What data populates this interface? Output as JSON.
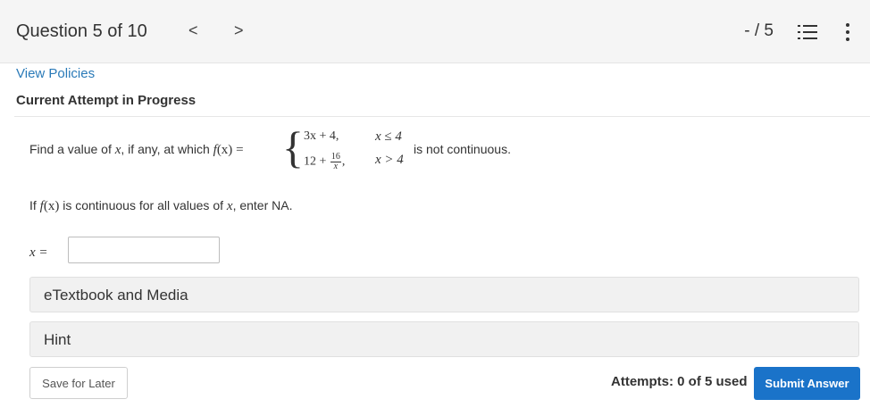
{
  "header": {
    "question_label": "Question 5 of 10",
    "prev_icon": "chevron-left-icon",
    "prev_glyph": "<",
    "next_icon": "chevron-right-icon",
    "next_glyph": ">",
    "score": "- / 5",
    "list_icon": "list-icon",
    "menu_icon": "more-vertical-icon"
  },
  "links": {
    "view_policies": "View Policies"
  },
  "attempt_title": "Current Attempt in Progress",
  "question": {
    "prompt_prefix": "Find a value of ",
    "var_x": "x",
    "prompt_mid": ", if any, at which ",
    "func": "f",
    "func_arg": "(x)",
    "equals": " =",
    "case1_expr": "3x + 4,",
    "case1_cond": "x ≤ 4",
    "case2_expr_prefix": "12 + ",
    "case2_frac_num": "16",
    "case2_frac_den": "x",
    "case2_expr_suffix": ",",
    "case2_cond": "x > 4",
    "prompt_suffix": "is not continuous.",
    "note_prefix": "If ",
    "note_func": "f",
    "note_arg": "(x)",
    "note_mid": " is continuous for all values of ",
    "note_var": "x",
    "note_suffix": ", enter NA."
  },
  "answer": {
    "label": "x =",
    "value": "",
    "placeholder": ""
  },
  "panels": {
    "etextbook": "eTextbook and Media",
    "hint": "Hint"
  },
  "footer": {
    "save_label": "Save for Later",
    "attempts": "Attempts: 0 of 5 used",
    "submit_label": "Submit Answer"
  },
  "colors": {
    "accent": "#1a73c9",
    "link": "#2a7ab8",
    "topbar_bg": "#f5f5f5",
    "panel_bg": "#f1f1f1"
  }
}
